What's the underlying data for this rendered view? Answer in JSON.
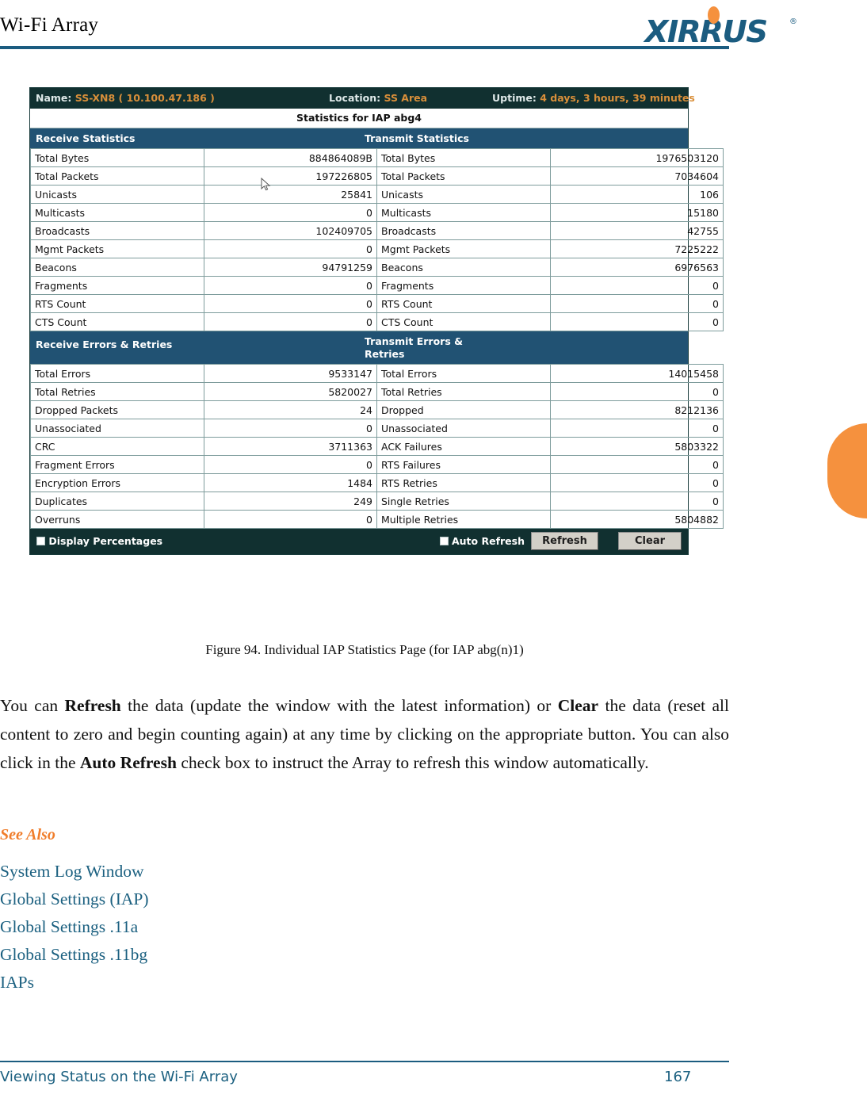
{
  "page": {
    "header_title": "Wi-Fi Array",
    "logo_text": "XIRRUS",
    "logo_reg": "®",
    "footer_section": "Viewing Status on the Wi-Fi Array",
    "footer_page_number": "167",
    "accent_orange": "#f5913e",
    "accent_blue": "#1b5c80"
  },
  "figure": {
    "caption": "Figure 94. Individual IAP Statistics Page (for IAP abg(n)1)"
  },
  "screenshot": {
    "topbar": {
      "name_label": "Name:",
      "name_value": "SS-XN8   ( 10.100.47.186 )",
      "location_label": "Location:",
      "location_value": "SS Area",
      "uptime_label": "Uptime:",
      "uptime_value": "4 days, 3 hours, 39 minutes"
    },
    "subtitle": "Statistics for IAP abg4",
    "sections": [
      {
        "left_header": "Receive Statistics",
        "right_header": "Transmit Statistics",
        "rows": [
          {
            "left_label": "Total Bytes",
            "left_value": "884864089B",
            "right_label": "Total Bytes",
            "right_value": "1976503120"
          },
          {
            "left_label": "Total Packets",
            "left_value": "197226805",
            "right_label": "Total Packets",
            "right_value": "7034604"
          },
          {
            "left_label": "Unicasts",
            "left_value": "25841",
            "right_label": "Unicasts",
            "right_value": "106"
          },
          {
            "left_label": "Multicasts",
            "left_value": "0",
            "right_label": "Multicasts",
            "right_value": "15180"
          },
          {
            "left_label": "Broadcasts",
            "left_value": "102409705",
            "right_label": "Broadcasts",
            "right_value": "42755"
          },
          {
            "left_label": "Mgmt Packets",
            "left_value": "0",
            "right_label": "Mgmt Packets",
            "right_value": "7225222"
          },
          {
            "left_label": "Beacons",
            "left_value": "94791259",
            "right_label": "Beacons",
            "right_value": "6976563"
          },
          {
            "left_label": "Fragments",
            "left_value": "0",
            "right_label": "Fragments",
            "right_value": "0"
          },
          {
            "left_label": "RTS Count",
            "left_value": "0",
            "right_label": "RTS Count",
            "right_value": "0"
          },
          {
            "left_label": "CTS Count",
            "left_value": "0",
            "right_label": "CTS Count",
            "right_value": "0"
          }
        ]
      },
      {
        "left_header": "Receive Errors & Retries",
        "right_header": "Transmit Errors & Retries",
        "rows": [
          {
            "left_label": "Total Errors",
            "left_value": "9533147",
            "right_label": "Total Errors",
            "right_value": "14015458"
          },
          {
            "left_label": "Total Retries",
            "left_value": "5820027",
            "right_label": "Total Retries",
            "right_value": "0"
          },
          {
            "left_label": "Dropped Packets",
            "left_value": "24",
            "right_label": "Dropped",
            "right_value": "8212136"
          },
          {
            "left_label": "Unassociated",
            "left_value": "0",
            "right_label": "Unassociated",
            "right_value": "0"
          },
          {
            "left_label": "CRC",
            "left_value": "3711363",
            "right_label": "ACK Failures",
            "right_value": "5803322"
          },
          {
            "left_label": "Fragment Errors",
            "left_value": "0",
            "right_label": "RTS Failures",
            "right_value": "0"
          },
          {
            "left_label": "Encryption Errors",
            "left_value": "1484",
            "right_label": "RTS Retries",
            "right_value": "0"
          },
          {
            "left_label": "Duplicates",
            "left_value": "249",
            "right_label": "Single Retries",
            "right_value": "0"
          },
          {
            "left_label": "Overruns",
            "left_value": "0",
            "right_label": "Multiple Retries",
            "right_value": "5804882"
          }
        ]
      }
    ],
    "footer": {
      "display_percentages_label": "Display Percentages",
      "display_percentages_checked": false,
      "auto_refresh_label": "Auto Refresh",
      "auto_refresh_checked": false,
      "refresh_button": "Refresh",
      "clear_button": "Clear"
    }
  },
  "body": {
    "paragraph_parts": [
      {
        "text": "You can ",
        "bold": false
      },
      {
        "text": "Refresh",
        "bold": true
      },
      {
        "text": " the data (update the window with the latest information) or ",
        "bold": false
      },
      {
        "text": "Clear",
        "bold": true
      },
      {
        "text": " the data (reset all content to zero and begin counting again) at any time by clicking on the appropriate button. You can also click in the ",
        "bold": false
      },
      {
        "text": "Auto Refresh",
        "bold": true
      },
      {
        "text": " check box to instruct the Array to refresh this window automatically.",
        "bold": false
      }
    ],
    "see_also_heading": "See Also",
    "see_also_links": [
      "System Log Window",
      "Global Settings (IAP)",
      "Global Settings .11a",
      "Global Settings .11bg",
      "IAPs"
    ]
  }
}
